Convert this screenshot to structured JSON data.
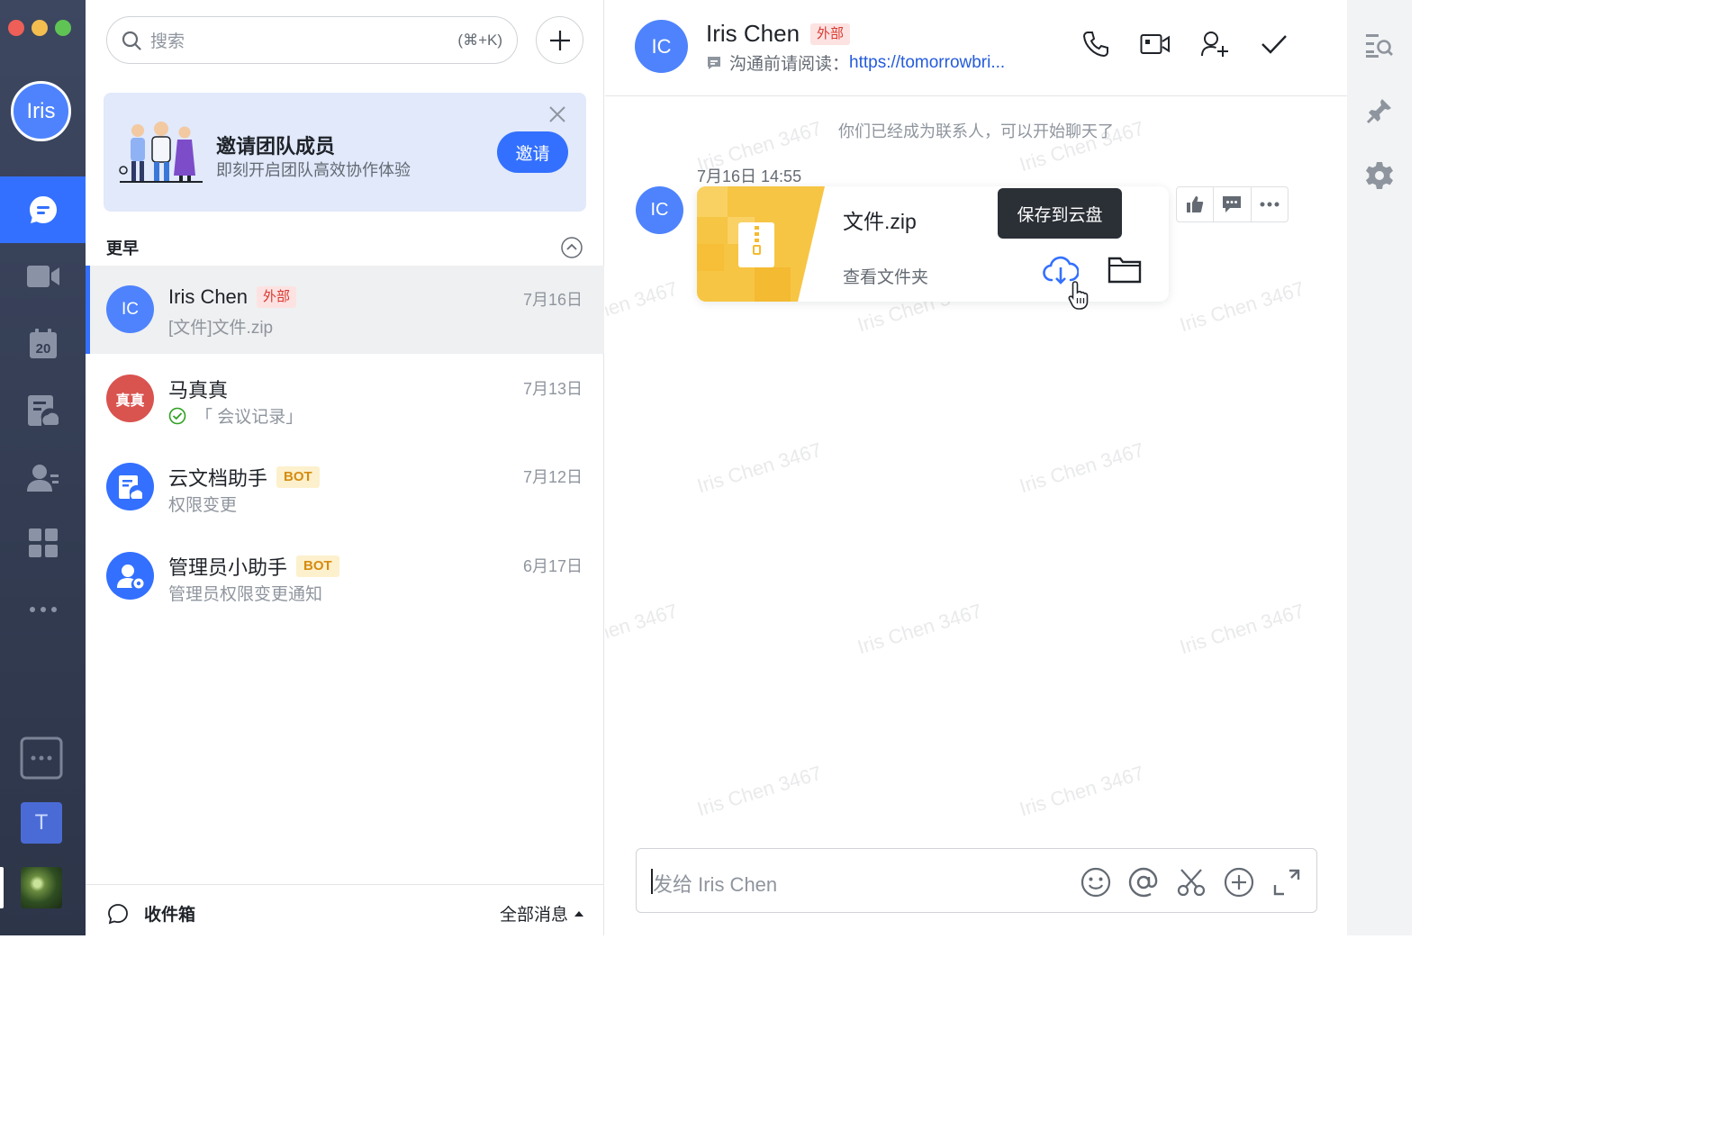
{
  "window": {
    "controls": [
      "close",
      "minimize",
      "zoom"
    ],
    "colors": {
      "close": "#ee5f57",
      "minimize": "#f4bd4f",
      "zoom": "#5fc454"
    }
  },
  "rail": {
    "profile_avatar": "Iris",
    "nav": [
      {
        "id": "messages",
        "icon": "chat-bubble-icon",
        "active": true
      },
      {
        "id": "video",
        "icon": "video-camera-icon"
      },
      {
        "id": "calendar",
        "icon": "calendar-icon",
        "label": "20"
      },
      {
        "id": "docs",
        "icon": "cloud-doc-icon"
      },
      {
        "id": "contacts",
        "icon": "contacts-icon"
      },
      {
        "id": "workplace",
        "icon": "app-grid-icon"
      },
      {
        "id": "more",
        "icon": "more-dots-icon"
      }
    ],
    "more_apps_icon": "more-apps-box-icon",
    "team_initial": "T",
    "accent": "#3370ff"
  },
  "search": {
    "placeholder": "搜索",
    "shortcut": "(⌘+K)"
  },
  "banner": {
    "title": "邀请团队成员",
    "subtitle": "即刻开启团队高效协作体验",
    "button": "邀请"
  },
  "section_label": "更早",
  "conversations": [
    {
      "name": "Iris Chen",
      "tag": "外部",
      "preview": "[文件]文件.zip",
      "date": "7月16日",
      "avatar": "IC",
      "avatar_color": "#4e83fd",
      "active": true
    },
    {
      "name": "马真真",
      "preview": "「 会议记录」",
      "date": "7月13日",
      "avatar": "真真",
      "avatar_color": "#d9534f",
      "status_icon": "check-circle-icon"
    },
    {
      "name": "云文档助手",
      "tag": "BOT",
      "preview": "权限变更",
      "date": "7月12日",
      "avatar_icon": "doc-bot-icon",
      "avatar_color": "#3370ff"
    },
    {
      "name": "管理员小助手",
      "tag": "BOT",
      "preview": "管理员权限变更通知",
      "date": "6月17日",
      "avatar_icon": "admin-bot-icon",
      "avatar_color": "#3370ff"
    }
  ],
  "footer": {
    "inbox": "收件箱",
    "filter": "全部消息"
  },
  "chat": {
    "contact_name": "Iris Chen",
    "contact_avatar": "IC",
    "contact_tag": "外部",
    "note_label": "沟通前请阅读：",
    "note_link": "https://tomorrowbri...",
    "system_message": "你们已经成为联系人，可以开始聊天了",
    "watermark": "Iris Chen 3467",
    "message": {
      "time": "7月16日 14:55",
      "file_name": "文件.zip",
      "open_folder": "查看文件夹",
      "tooltip": "保存到云盘"
    },
    "composer_placeholder": "发给 Iris Chen"
  },
  "utility_icons": [
    "search-list-icon",
    "pin-icon",
    "settings-gear-icon"
  ]
}
